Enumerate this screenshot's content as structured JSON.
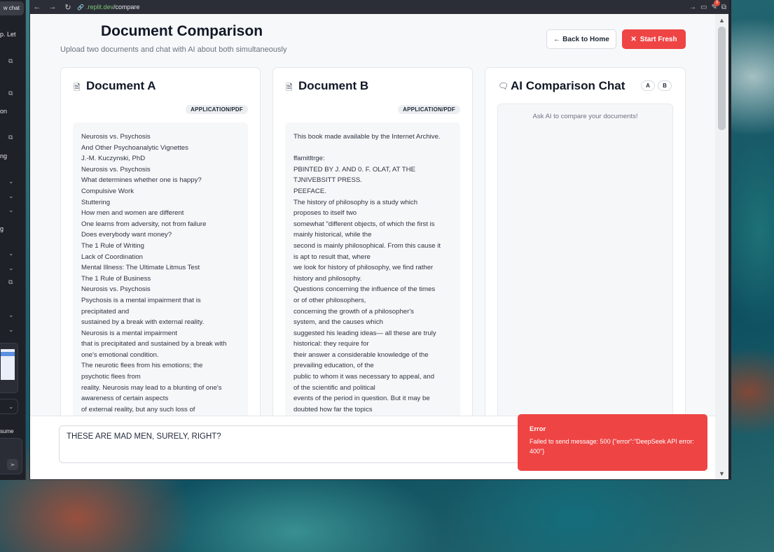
{
  "left_panel": {
    "new_chat": "w chat",
    "fragments": [
      "p. Let",
      "on",
      "ng",
      "g"
    ],
    "resume": "sume"
  },
  "browser": {
    "url_host": ".replit.dev",
    "url_path": "/compare",
    "notification_count": "3"
  },
  "header": {
    "title": "Document Comparison",
    "subtitle": "Upload two documents and chat with AI about both simultaneously",
    "back_button": "Back to Home",
    "fresh_button": "Start Fresh"
  },
  "doc_a": {
    "title": "Document A",
    "mime": "APPLICATION/PDF",
    "lines": [
      "Neurosis vs. Psychosis",
      "And Other Psychoanalytic Vignettes",
      "J.-M. Kuczynski, PhD",
      "Neurosis vs. Psychosis",
      "What determines whether one is happy?",
      "Compulsive Work",
      "Stuttering",
      "How men and women are different",
      "One learns from adversity, not from failure",
      "Does everybody want money?",
      "The 1 Rule of Writing",
      "Lack of Coordination",
      "Mental Illness: The Ultimate Litmus Test",
      "The 1 Rule of Business",
      "Neurosis vs. Psychosis",
      "Psychosis is a mental impairment that is",
      "precipitated and",
      "sustained by a break with external reality.",
      "Neurosis is a mental impairment",
      "that is precipitated and sustained by a break with",
      "one's emotional condition.",
      "The neurotic flees from his emotions; the",
      "psychotic flees from",
      "reality. Neurosis may lead to a blunting of one's",
      "awareness of certain aspects",
      "of external reality, but any such loss of"
    ]
  },
  "doc_b": {
    "title": "Document B",
    "mime": "APPLICATION/PDF",
    "lines": [
      "This book made available by the Internet Archive.",
      "",
      "ffamitltrge:",
      "PBINTED BY J. AND 0. F. OLAT, AT THE",
      "TJNIVEBSITT PRESS.",
      "PEEFACE.",
      "The history of philosophy is a study which",
      "proposes to itself two",
      "somewhat \"different objects, of which the first is",
      "mainly historical, while the",
      "second is mainly philosophical. From this cause it",
      "is apt to result that, where",
      "we look for history of philosophy, we find rather",
      "history and philosophy.",
      "Questions concerning the influence of the times",
      "or of other philosophers,",
      "concerning the growth of a philosopher's",
      "system, and the causes which",
      "suggested his leading ideas— all these are truly",
      "historical: they require for",
      "their answer a considerable knowledge of the",
      "prevailing education, of the",
      "public to whom it was necessary to appeal, and",
      "of the scientific and political",
      "events of the period in question. But it may be",
      "doubted how far the topics"
    ]
  },
  "chat": {
    "title": "AI Comparison Chat",
    "pill_a": "A",
    "pill_b": "B",
    "empty_text": "Ask AI to compare your documents!",
    "input_value": "THESE ARE MAD MEN, SURELY, RIGHT?"
  },
  "toast": {
    "title": "Error",
    "message": "Failed to send message: 500 {\"error\":\"DeepSeek API error: 400\"}"
  },
  "colors": {
    "danger": "#ef4444",
    "text_primary": "#111827"
  }
}
